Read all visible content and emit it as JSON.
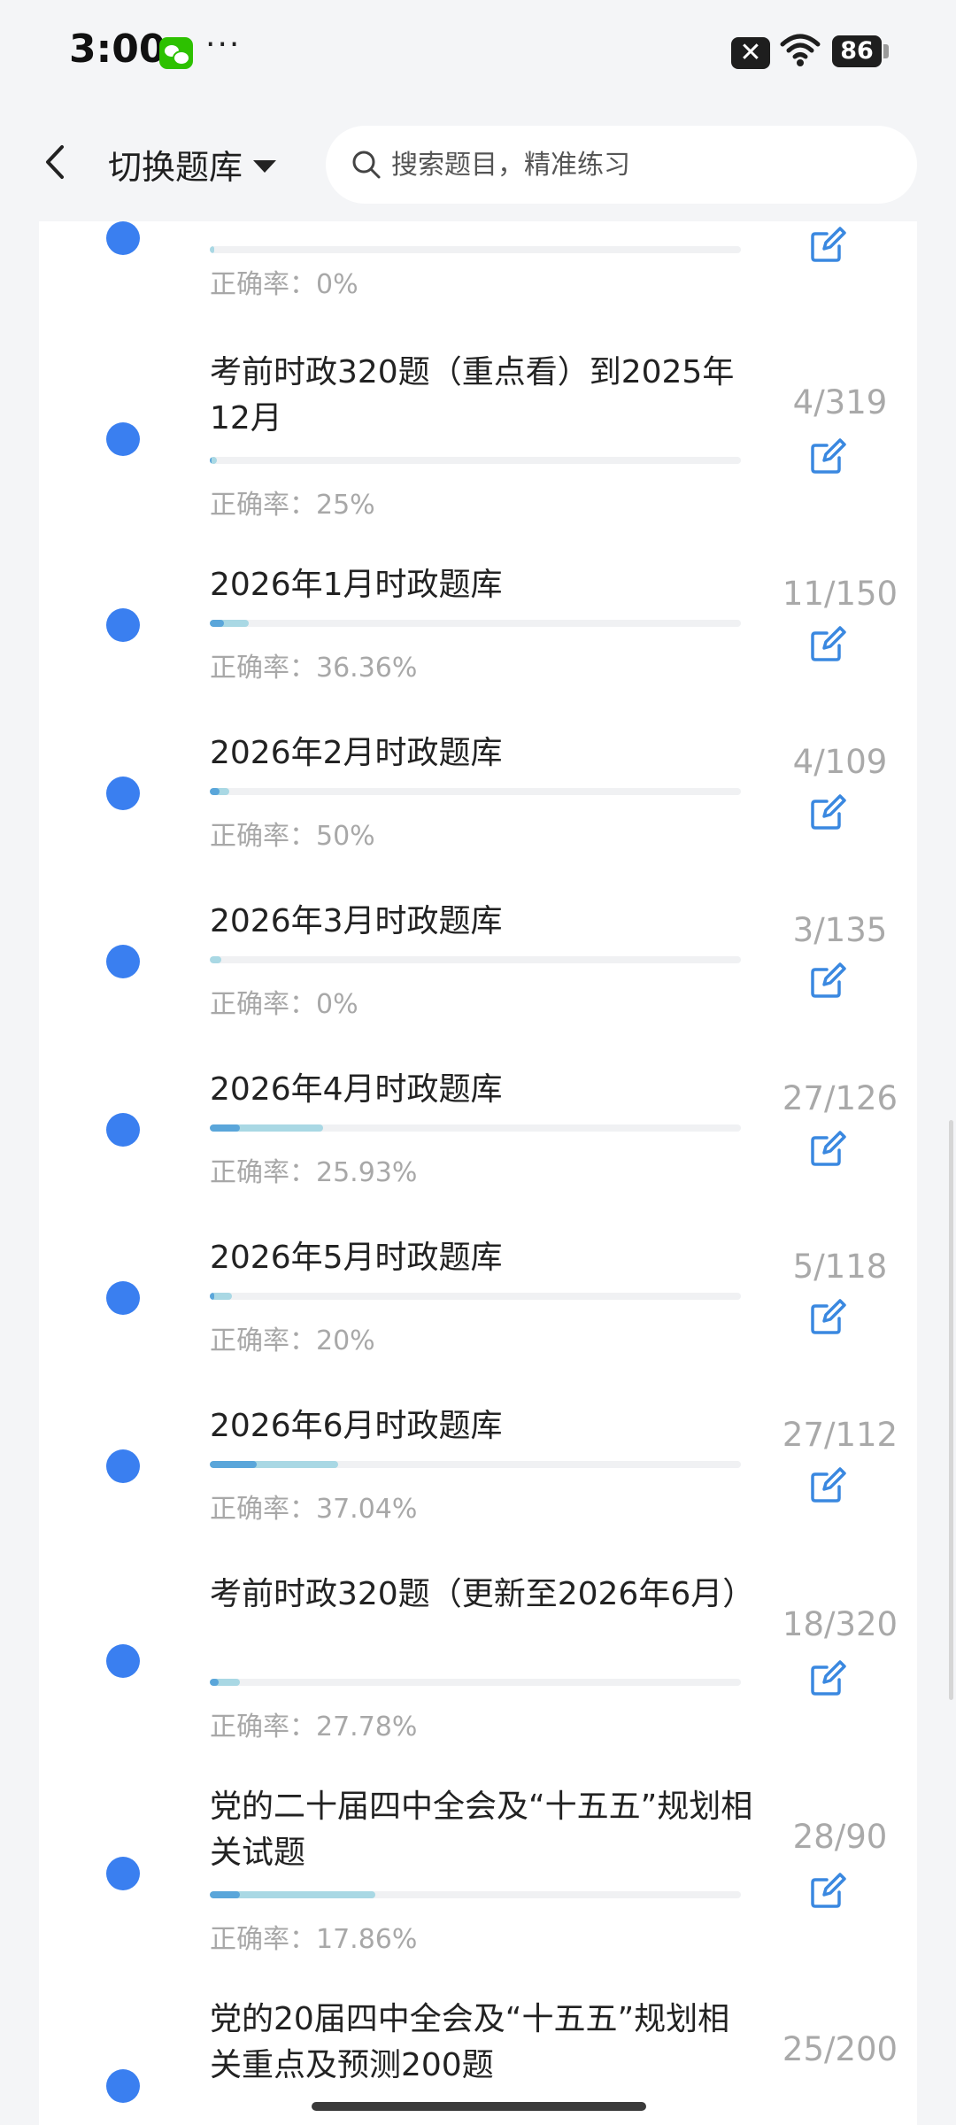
{
  "status_bar": {
    "time": "3:00",
    "dots": "···",
    "battery": "86"
  },
  "header": {
    "switch_label": "切换题库",
    "search_placeholder": "搜索题目，精准练习"
  },
  "accuracy_prefix": "正确率：",
  "colors": {
    "accent": "#3a7ff0",
    "edit_icon": "#3a88e0",
    "progress_light": "#a9d8e4",
    "progress_dark": "#5aa6da"
  },
  "items": [
    {
      "title": "",
      "accuracy": "0%",
      "count": "",
      "progress": 0,
      "correct": 0
    },
    {
      "title": "考前时政320题（重点看）到2025年12月",
      "accuracy": "25%",
      "count": "4/319",
      "progress": 0.0125,
      "correct": 0.003
    },
    {
      "title": "2026年1月时政题库",
      "accuracy": "36.36%",
      "count": "11/150",
      "progress": 0.073,
      "correct": 0.027
    },
    {
      "title": "2026年2月时政题库",
      "accuracy": "50%",
      "count": "4/109",
      "progress": 0.037,
      "correct": 0.018
    },
    {
      "title": "2026年3月时政题库",
      "accuracy": "0%",
      "count": "3/135",
      "progress": 0.022,
      "correct": 0
    },
    {
      "title": "2026年4月时政题库",
      "accuracy": "25.93%",
      "count": "27/126",
      "progress": 0.214,
      "correct": 0.056
    },
    {
      "title": "2026年5月时政题库",
      "accuracy": "20%",
      "count": "5/118",
      "progress": 0.042,
      "correct": 0.008
    },
    {
      "title": "2026年6月时政题库",
      "accuracy": "37.04%",
      "count": "27/112",
      "progress": 0.241,
      "correct": 0.089
    },
    {
      "title": "考前时政320题（更新至2026年6月）",
      "accuracy": "27.78%",
      "count": "18/320",
      "progress": 0.056,
      "correct": 0.016
    },
    {
      "title": "党的二十届四中全会及“十五五”规划相关试题",
      "accuracy": "17.86%",
      "count": "28/90",
      "progress": 0.311,
      "correct": 0.056
    },
    {
      "title": "党的20届四中全会及“十五五”规划相关重点及预测200题",
      "accuracy": "",
      "count": "25/200",
      "progress": 0,
      "correct": 0
    }
  ]
}
